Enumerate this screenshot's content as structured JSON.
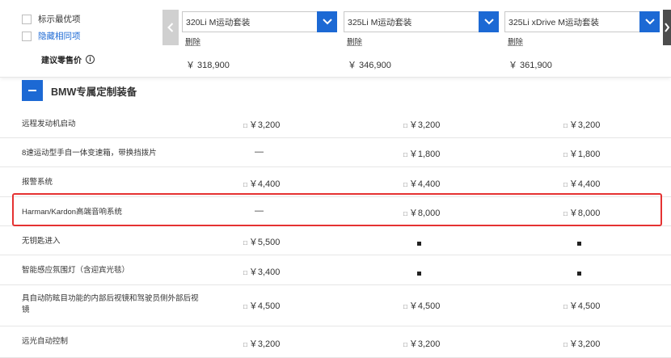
{
  "options": {
    "mark_best": "标示最优项",
    "hide_same": "隐藏相同项"
  },
  "price_label": "建议零售价",
  "models": [
    {
      "name": "320Li M运动套装",
      "delete": "删除",
      "price": "￥ 318,900"
    },
    {
      "name": "325Li M运动套装",
      "delete": "删除",
      "price": "￥ 346,900"
    },
    {
      "name": "325Li xDrive M运动套装",
      "delete": "删除",
      "price": "￥ 361,900"
    }
  ],
  "section": {
    "title": "BMW专属定制装备"
  },
  "rows": [
    {
      "name": "远程发动机启动",
      "cells": [
        {
          "t": "opt",
          "v": "￥3,200"
        },
        {
          "t": "opt",
          "v": "￥3,200"
        },
        {
          "t": "opt",
          "v": "￥3,200"
        }
      ]
    },
    {
      "name": "8速运动型手自一体变速箱，带换挡拨片",
      "cells": [
        {
          "t": "dash",
          "v": "—"
        },
        {
          "t": "opt",
          "v": "￥1,800"
        },
        {
          "t": "opt",
          "v": "￥1,800"
        }
      ]
    },
    {
      "name": "报警系统",
      "cells": [
        {
          "t": "opt",
          "v": "￥4,400"
        },
        {
          "t": "opt",
          "v": "￥4,400"
        },
        {
          "t": "opt",
          "v": "￥4,400"
        }
      ]
    },
    {
      "name": "Harman/Kardon高端音响系统",
      "cells": [
        {
          "t": "dash",
          "v": "—"
        },
        {
          "t": "opt",
          "v": "￥8,000"
        },
        {
          "t": "opt",
          "v": "￥8,000"
        }
      ]
    },
    {
      "name": "无钥匙进入",
      "cells": [
        {
          "t": "opt",
          "v": "￥5,500"
        },
        {
          "t": "std",
          "v": ""
        },
        {
          "t": "std",
          "v": ""
        }
      ]
    },
    {
      "name": "智能感应氛围灯（含迎宾光毯）",
      "cells": [
        {
          "t": "opt",
          "v": "￥3,400"
        },
        {
          "t": "std",
          "v": ""
        },
        {
          "t": "std",
          "v": ""
        }
      ]
    },
    {
      "name": "具自动防眩目功能的内部后视镜和驾驶员侧外部后视镜",
      "cells": [
        {
          "t": "opt",
          "v": "￥4,500"
        },
        {
          "t": "opt",
          "v": "￥4,500"
        },
        {
          "t": "opt",
          "v": "￥4,500"
        }
      ]
    },
    {
      "name": "远光自动控制",
      "cells": [
        {
          "t": "opt",
          "v": "￥3,200"
        },
        {
          "t": "opt",
          "v": "￥3,200"
        },
        {
          "t": "opt",
          "v": "￥3,200"
        }
      ]
    }
  ],
  "colors": {
    "accent": "#1c69d4",
    "highlight": "#e53232"
  },
  "icons": {
    "option_mark": "option-mark-icon",
    "standard_mark": "standard-square-icon"
  }
}
